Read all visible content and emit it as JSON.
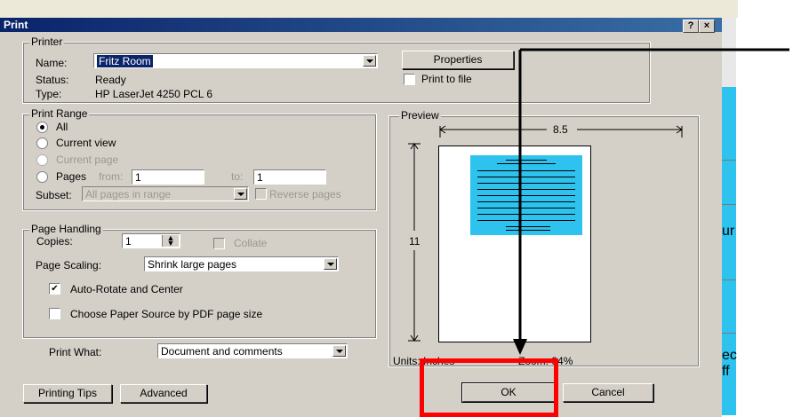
{
  "dialog": {
    "title": "Print",
    "help_btn": "?",
    "close_btn": "×"
  },
  "printer": {
    "group": "Printer",
    "name_label": "Name:",
    "name_value": "Fritz Room",
    "status_label": "Status:",
    "status_value": "Ready",
    "type_label": "Type:",
    "type_value": "HP LaserJet 4250 PCL 6",
    "properties_btn": "Properties",
    "print_to_file": "Print to file"
  },
  "range": {
    "group": "Print Range",
    "all": "All",
    "current_view": "Current view",
    "current_page": "Current page",
    "pages_label": "Pages",
    "from_label": "from:",
    "from_value": "1",
    "to_label": "to:",
    "to_value": "1",
    "subset_label": "Subset:",
    "subset_value": "All pages in range",
    "reverse": "Reverse pages"
  },
  "handling": {
    "group": "Page Handling",
    "copies_label": "Copies:",
    "copies_value": "1",
    "collate": "Collate",
    "scaling_label": "Page Scaling:",
    "scaling_value": "Shrink large pages",
    "auto_rotate": "Auto-Rotate and Center",
    "paper_source": "Choose Paper Source by PDF page size"
  },
  "what": {
    "label": "Print What:",
    "value": "Document and comments"
  },
  "preview": {
    "group": "Preview",
    "width": "8.5",
    "height": "11",
    "units": "Units: Inches",
    "zoom": "Zoom: 94%"
  },
  "buttons": {
    "tips": "Printing Tips",
    "advanced": "Advanced",
    "ok": "OK",
    "cancel": "Cancel"
  },
  "background": {
    "text_1": "ur",
    "text_2": "ec",
    "text_3": "ff"
  },
  "colors": {
    "annotation_box": "#ff0000",
    "arrow": "#000000",
    "document_fill": "#2ec3ee"
  }
}
